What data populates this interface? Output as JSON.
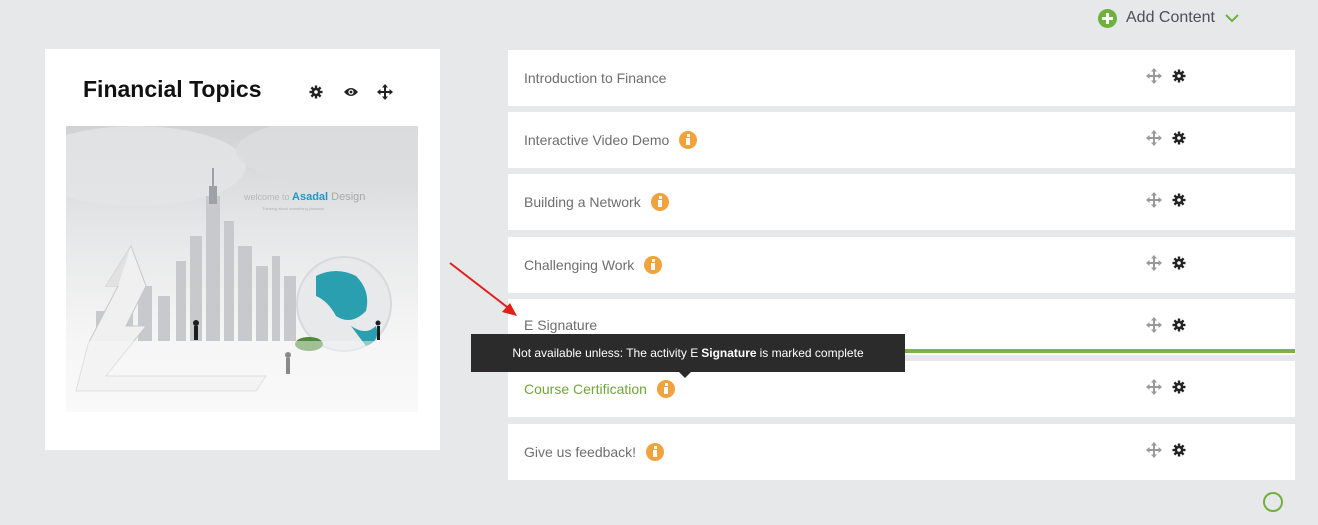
{
  "header": {
    "add_content_label": "Add Content",
    "add_icon": "plus-circle-icon",
    "dropdown_icon": "chevron-down-icon"
  },
  "course": {
    "title": "Financial Topics",
    "icons": [
      "gear-icon",
      "eye-icon",
      "move-icon"
    ],
    "image": {
      "welcome_prefix": "welcome to ",
      "brand": "Asadal",
      "brand_suffix": " Design",
      "tagline": "Thinking about something pleasant"
    }
  },
  "activities": [
    {
      "name": "Introduction to Finance",
      "info": false
    },
    {
      "name": "Interactive Video Demo",
      "info": true
    },
    {
      "name": "Building a Network",
      "info": true
    },
    {
      "name": "Challenging Work",
      "info": true
    },
    {
      "name": "E Signature",
      "info": false
    },
    {
      "name": "Course Certification",
      "info": true,
      "completed": true
    },
    {
      "name": "Give us feedback!",
      "info": true
    }
  ],
  "tooltip": {
    "prefix": "Not available unless: The activity E",
    "bold": "Signature",
    "suffix": "is marked complete"
  },
  "colors": {
    "accent_green": "#7cb342",
    "info_orange": "#f0a33d",
    "tooltip_bg": "#2b2b2b",
    "annotation_red": "#e0201b"
  }
}
